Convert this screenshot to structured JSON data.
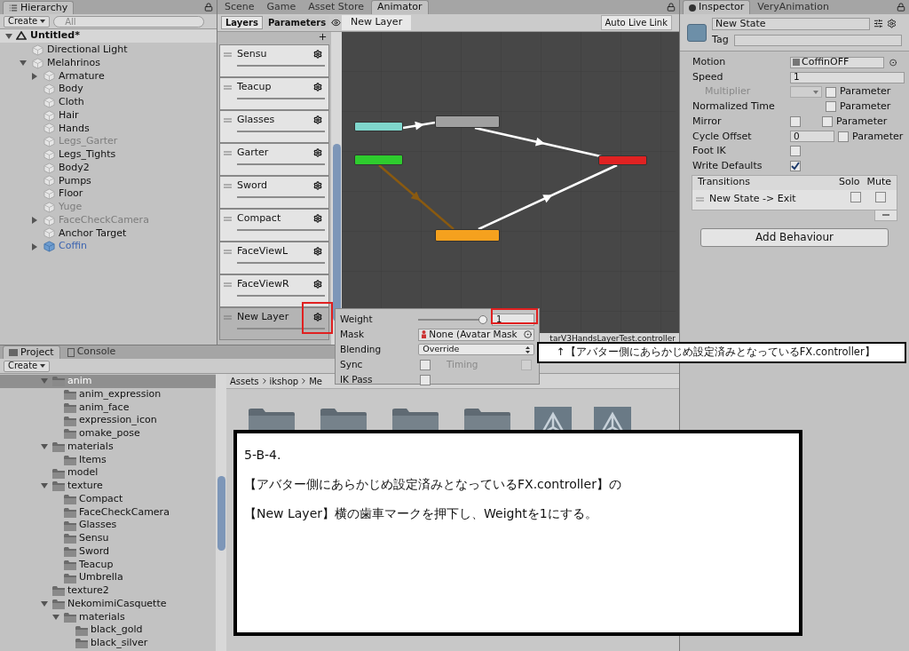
{
  "hierarchy": {
    "tab": "Hierarchy",
    "create": "Create",
    "search_placeholder": "All",
    "scene": "Untitled*",
    "items": [
      {
        "label": "Directional Light",
        "kind": "object",
        "active": true,
        "selected": false
      },
      {
        "label": "Melahrinos",
        "kind": "object",
        "active": true,
        "selected": false,
        "expanded": true,
        "children": [
          {
            "label": "Armature",
            "kind": "object",
            "active": true,
            "selected": false,
            "expanded": false
          },
          {
            "label": "Body",
            "kind": "object",
            "active": true,
            "selected": false
          },
          {
            "label": "Cloth",
            "kind": "object",
            "active": true,
            "selected": false
          },
          {
            "label": "Hair",
            "kind": "object",
            "active": true,
            "selected": false
          },
          {
            "label": "Hands",
            "kind": "object",
            "active": true,
            "selected": false
          },
          {
            "label": "Legs_Garter",
            "kind": "object",
            "active": false,
            "selected": false
          },
          {
            "label": "Legs_Tights",
            "kind": "object",
            "active": true,
            "selected": false
          },
          {
            "label": "Body2",
            "kind": "object",
            "active": true,
            "selected": false
          },
          {
            "label": "Pumps",
            "kind": "object",
            "active": true,
            "selected": false
          },
          {
            "label": "Floor",
            "kind": "object",
            "active": true,
            "selected": false
          },
          {
            "label": "Yuge",
            "kind": "object",
            "active": false,
            "selected": false
          },
          {
            "label": "FaceCheckCamera",
            "kind": "object",
            "active": false,
            "selected": false,
            "expanded": false
          },
          {
            "label": "Anchor Target",
            "kind": "object",
            "active": true,
            "selected": false
          },
          {
            "label": "Coffin",
            "kind": "prefab",
            "active": true,
            "selected": false,
            "expanded": false
          }
        ]
      }
    ]
  },
  "animator": {
    "tabs": [
      {
        "label": "Scene",
        "selected": false
      },
      {
        "label": "Game",
        "selected": false
      },
      {
        "label": "Asset Store",
        "selected": false
      },
      {
        "label": "Animator",
        "selected": true
      }
    ],
    "side_tabs": [
      {
        "label": "Layers",
        "selected": true
      },
      {
        "label": "Parameters",
        "selected": false
      }
    ],
    "breadcrumb": "New Layer",
    "live_link": "Auto Live Link",
    "layers": [
      {
        "name": "Sensu",
        "selected": false
      },
      {
        "name": "Teacup",
        "selected": false
      },
      {
        "name": "Glasses",
        "selected": false
      },
      {
        "name": "Garter",
        "selected": false
      },
      {
        "name": "Sword",
        "selected": false
      },
      {
        "name": "Compact",
        "selected": false
      },
      {
        "name": "FaceViewL",
        "selected": false
      },
      {
        "name": "FaceViewR",
        "selected": false
      },
      {
        "name": "New Layer",
        "selected": true
      }
    ],
    "states": [
      {
        "color": "#7fd6cc"
      },
      {
        "color": "#a0a0a0"
      },
      {
        "color": "#2ecc2e"
      },
      {
        "color": "#e02222"
      },
      {
        "color": "#f5a11e"
      }
    ],
    "path": "tarV3HandsLayerTest.controller",
    "layer_settings": {
      "weight_label": "Weight",
      "level": 1,
      "weight": "1",
      "mask_label": "Mask",
      "mask": "None (Avatar Mask",
      "blending_label": "Blending",
      "blending": "Override",
      "sync_label": "Sync",
      "sync": false,
      "timing_label": "Timing",
      "timing": false,
      "timing_disabled": true,
      "ik_label": "IK Pass",
      "ik_pass": false
    }
  },
  "inspector": {
    "tabs": [
      {
        "label": "Inspector",
        "selected": true
      },
      {
        "label": "VeryAnimation",
        "selected": false
      }
    ],
    "name": "New State",
    "tag_label": "Tag",
    "properties": [
      {
        "kind": "object",
        "label": "Motion",
        "value": "CoffinOFF"
      },
      {
        "kind": "text",
        "label": "Speed",
        "value": "1"
      },
      {
        "kind": "dropdown",
        "label": "Multiplier",
        "disabled": true,
        "parameter_label": "Parameter",
        "parameter_checked": false
      },
      {
        "kind": "parameter",
        "label": "Normalized Time",
        "parameter_label": "Parameter",
        "parameter_checked": false
      },
      {
        "kind": "toggle",
        "label": "Mirror",
        "checked": false,
        "parameter_label": "Parameter",
        "parameter_checked": false
      },
      {
        "kind": "text",
        "label": "Cycle Offset",
        "value": "0",
        "parameter_label": "Parameter",
        "parameter_checked": false
      },
      {
        "kind": "toggle",
        "label": "Foot IK",
        "checked": false
      },
      {
        "kind": "toggle",
        "label": "Write Defaults",
        "checked": true
      }
    ],
    "transitions": {
      "title": "Transitions",
      "solo_label": "Solo",
      "mute_label": "Mute",
      "rows": [
        {
          "label": "New State -> Exit",
          "solo": false,
          "mute": false
        }
      ]
    },
    "add_button": "Add Behaviour"
  },
  "project": {
    "tabs": [
      {
        "label": "Project",
        "selected": true
      },
      {
        "label": "Console",
        "selected": false
      }
    ],
    "create": "Create",
    "tree": [
      {
        "label": "anim",
        "selected": true,
        "expanded": true,
        "children": [
          {
            "label": "anim_expression",
            "selected": false
          },
          {
            "label": "anim_face",
            "selected": false
          },
          {
            "label": "expression_icon",
            "selected": false
          },
          {
            "label": "omake_pose",
            "selected": false
          }
        ]
      },
      {
        "label": "materials",
        "selected": false,
        "expanded": true,
        "children": [
          {
            "label": "Items",
            "selected": false
          }
        ]
      },
      {
        "label": "model",
        "selected": false
      },
      {
        "label": "texture",
        "selected": false,
        "expanded": true,
        "children": [
          {
            "label": "Compact",
            "selected": false
          },
          {
            "label": "FaceCheckCamera",
            "selected": false
          },
          {
            "label": "Glasses",
            "selected": false
          },
          {
            "label": "Sensu",
            "selected": false
          },
          {
            "label": "Sword",
            "selected": false
          },
          {
            "label": "Teacup",
            "selected": false
          },
          {
            "label": "Umbrella",
            "selected": false
          }
        ]
      },
      {
        "label": "texture2",
        "selected": false
      },
      {
        "label": "NekomimiCasquette",
        "selected": false,
        "expanded": true,
        "children": [
          {
            "label": "materials",
            "selected": false,
            "expanded": true,
            "children": [
              {
                "label": "black_gold",
                "selected": false
              },
              {
                "label": "black_silver",
                "selected": false
              }
            ]
          }
        ]
      }
    ],
    "breadcrumb": [
      "Assets",
      "ikshop",
      "Me"
    ],
    "assets": [
      {
        "kind": "folder"
      },
      {
        "kind": "folder"
      },
      {
        "kind": "folder"
      },
      {
        "kind": "folder"
      },
      {
        "kind": "unity"
      },
      {
        "kind": "unity"
      }
    ]
  },
  "callout": "↑【アバター側にあらかじめ設定済みとなっているFX.controller】",
  "note": {
    "lines": [
      "5-B-4.",
      "【アバター側にあらかじめ設定済みとなっているFX.controller】の",
      "【New Layer】横の歯車マークを押下し、Weightを1にする。"
    ]
  }
}
